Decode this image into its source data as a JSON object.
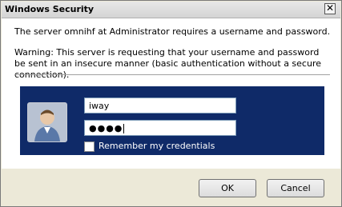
{
  "window": {
    "title": "Windows Security",
    "close_glyph": "✕"
  },
  "message": {
    "line1": "The server omnihf at Administrator requires a username and password.",
    "warning": "Warning: This server is requesting that your username and password be sent in an insecure manner (basic authentication without a secure connection)."
  },
  "credentials": {
    "username": "iway",
    "password_mask": "●●●●",
    "remember_label": "Remember my credentials",
    "remember_checked": false,
    "avatar_icon": "user-avatar-icon",
    "panel_color": "#0f2a68"
  },
  "buttons": {
    "ok": "OK",
    "cancel": "Cancel"
  }
}
